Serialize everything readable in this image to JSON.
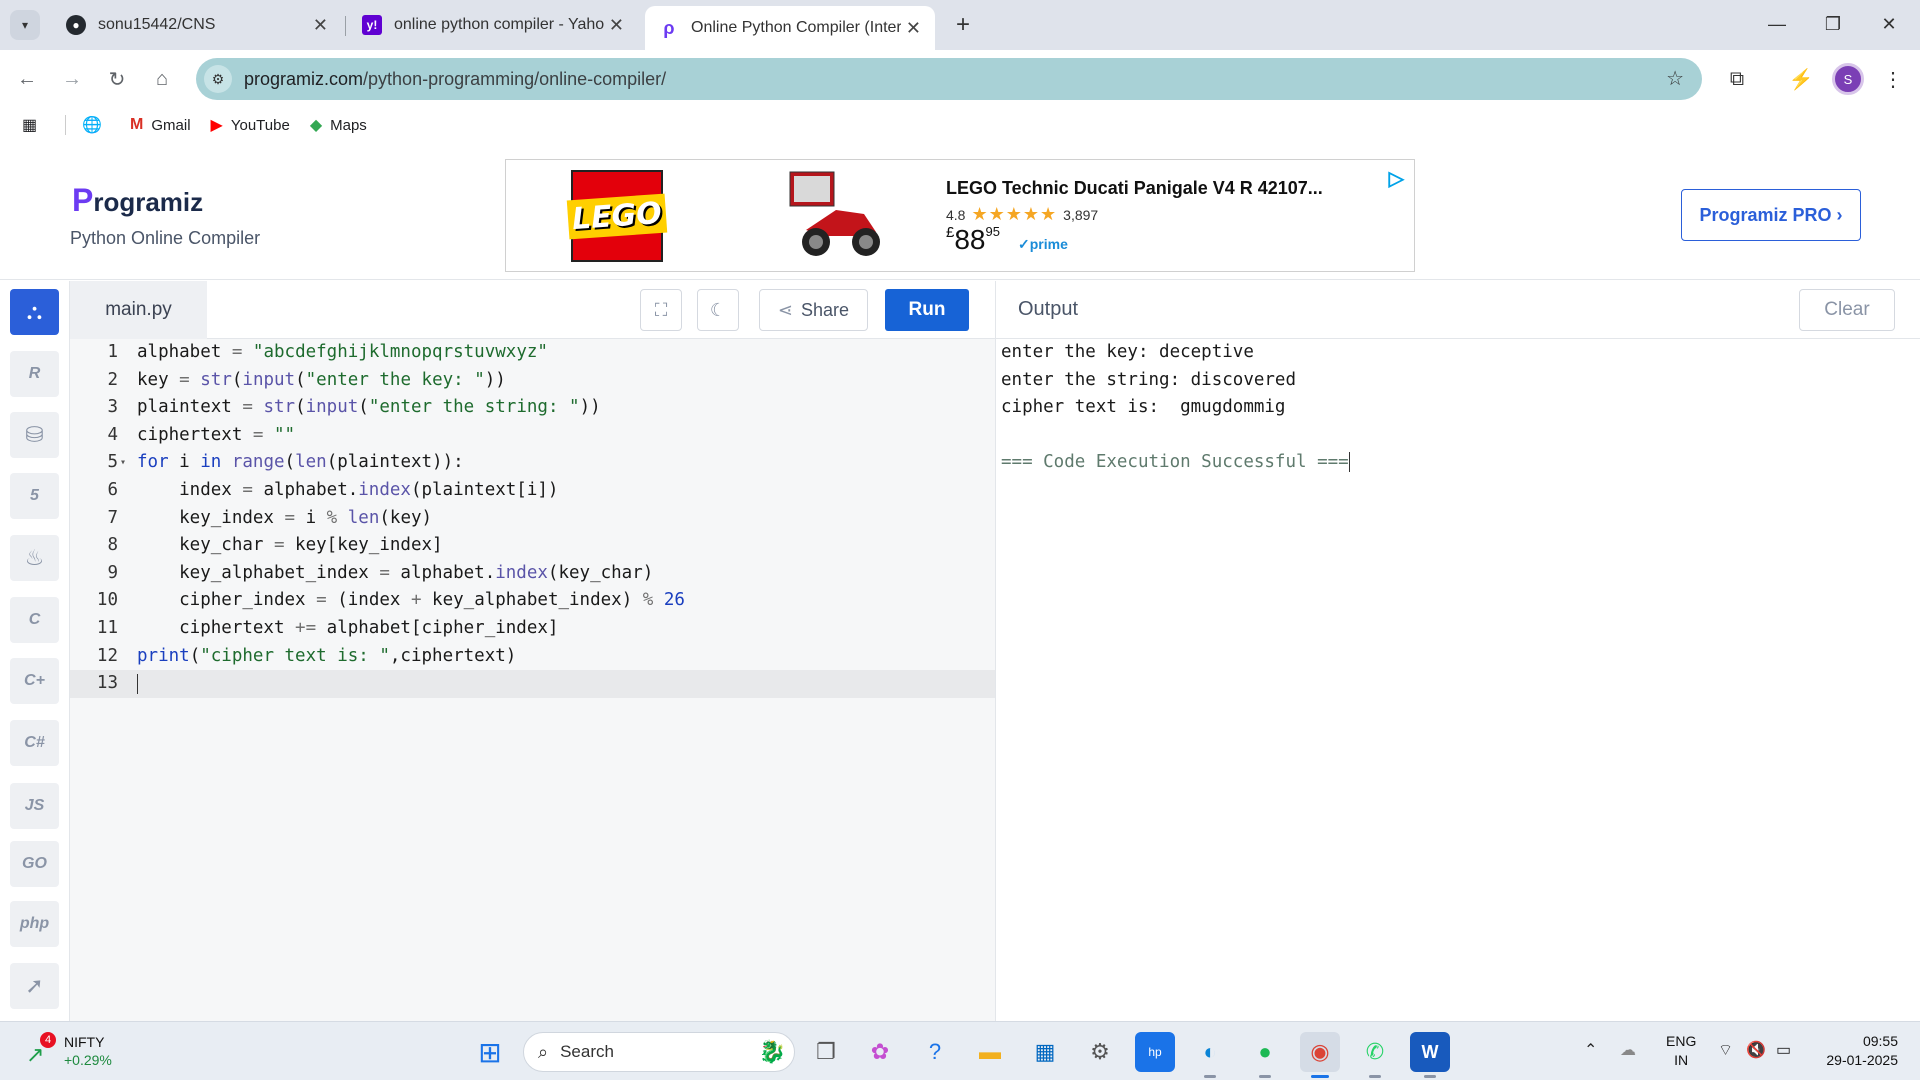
{
  "browser": {
    "tabs": [
      {
        "title": "sonu15442/CNS",
        "icon": "github-icon"
      },
      {
        "title": "online python compiler - Yahoo",
        "icon": "yahoo-icon"
      },
      {
        "title": "Online Python Compiler (Interp",
        "icon": "programiz-icon"
      }
    ],
    "url_domain": "programiz.com",
    "url_path": "/python-programming/online-compiler/",
    "profile_initial": "S",
    "bookmarks": [
      {
        "label": "Gmail",
        "icon": "gmail-icon"
      },
      {
        "label": "YouTube",
        "icon": "youtube-icon"
      },
      {
        "label": "Maps",
        "icon": "maps-icon"
      }
    ]
  },
  "header": {
    "logo": "rogramiz",
    "logo_initial": "P",
    "subtitle": "Python Online Compiler",
    "pro_button": "Programiz PRO ›"
  },
  "ad": {
    "brand": "LEGO",
    "title": "LEGO Technic Ducati Panigale V4 R 42107...",
    "rating": "4.8",
    "stars": "★★★★★",
    "reviews": "3,897",
    "currency": "£",
    "price_whole": "88",
    "price_fraction": "95",
    "prime": "✓prime"
  },
  "editor": {
    "filename": "main.py",
    "share_label": "Share",
    "run_label": "Run",
    "line_numbers": [
      "1",
      "2",
      "3",
      "4",
      "5",
      "6",
      "7",
      "8",
      "9",
      "10",
      "11",
      "12",
      "13"
    ]
  },
  "output": {
    "title": "Output",
    "clear_label": "Clear",
    "lines": [
      "enter the key: deceptive",
      "enter the string: discovered",
      "cipher text is:  gmugdommig",
      "",
      "=== Code Execution Successful ==="
    ]
  },
  "taskbar": {
    "nifty_name": "NIFTY",
    "nifty_change": "+0.29%",
    "nifty_badge": "4",
    "search_label": "Search",
    "language": "ENG",
    "region": "IN",
    "time": "09:55",
    "date": "29-01-2025"
  },
  "colors": {
    "accent": "#1763d6",
    "omnibox": "#a8d1d6",
    "keyword": "#1a3fbf",
    "string": "#1e6b2e"
  }
}
